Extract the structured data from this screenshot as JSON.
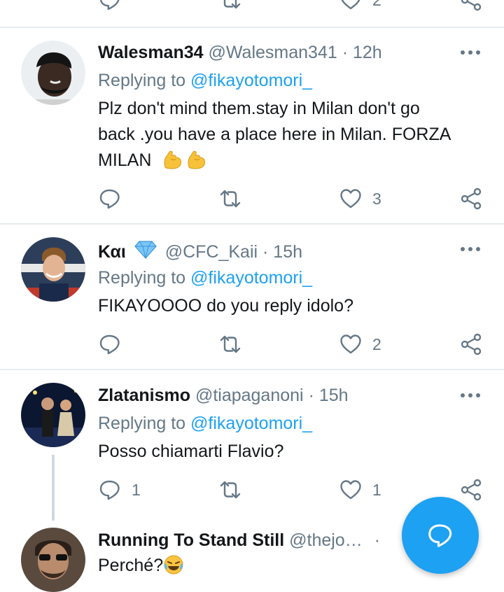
{
  "top_actions": {
    "like_count": "2"
  },
  "tweets": [
    {
      "name": "Walesman34",
      "handle": "@Walesman341",
      "time": "12h",
      "replying_prefix": "Replying to ",
      "replying_to": "@fikayotomori_",
      "text_lines": [
        "Plz don't mind them.stay in Milan don't go",
        "back .you have a place here in Milan. FORZA",
        "MILAN"
      ],
      "reply_count": "",
      "like_count": "3"
    },
    {
      "name": "Και",
      "handle": "@CFC_Kaii",
      "time": "15h",
      "replying_prefix": "Replying to ",
      "replying_to": "@fikayotomori_",
      "text_lines": [
        "FIKAYOOOO do you reply idolo?"
      ],
      "reply_count": "",
      "like_count": "2"
    },
    {
      "name": "Zlatanismo",
      "handle": "@tiapaganoni",
      "time": "15h",
      "replying_prefix": "Replying to ",
      "replying_to": "@fikayotomori_",
      "text_lines": [
        "Posso chiamarti Flavio?"
      ],
      "reply_count": "1",
      "like_count": "1"
    },
    {
      "name": "Running To Stand Still",
      "handle": "@thejo…",
      "time": "",
      "text_lines": [
        "Perché?"
      ]
    }
  ],
  "separator": "·",
  "colors": {
    "accent": "#1da1f2",
    "muted": "#657786",
    "text": "#14171a",
    "divider": "#e6ecf0"
  },
  "icons": [
    "reply-icon",
    "retweet-icon",
    "like-icon",
    "share-icon",
    "more-icon",
    "verified-diamond-icon",
    "flexed-biceps-emoji",
    "laughing-crying-emoji",
    "compose-icon"
  ]
}
